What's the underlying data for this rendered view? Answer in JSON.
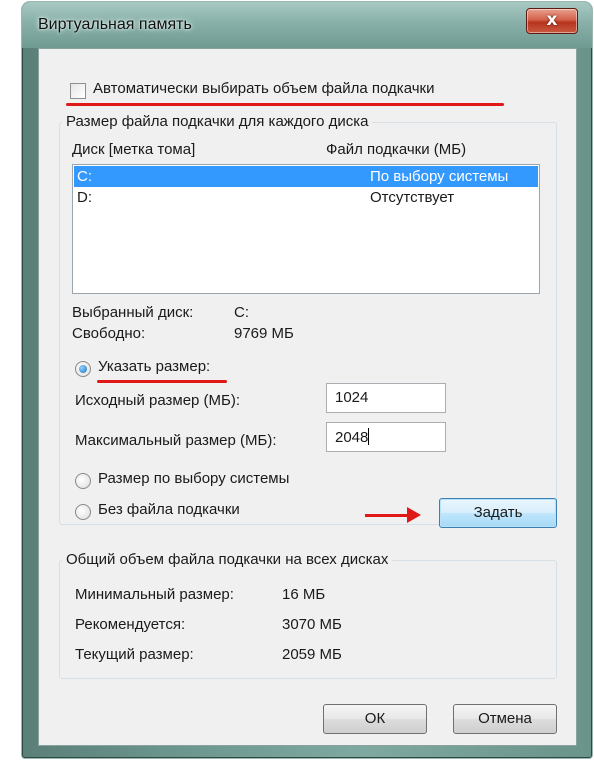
{
  "window": {
    "title": "Виртуальная память",
    "close_label": "x"
  },
  "auto_checkbox": {
    "label": "Автоматически выбирать объем файла подкачки",
    "checked": false
  },
  "drives_group": {
    "title": "Размер файла подкачки для каждого диска",
    "col_drive": "Диск [метка тома]",
    "col_pagefile": "Файл подкачки (МБ)",
    "rows": [
      {
        "drive": "C:",
        "pagefile": "По выбору системы",
        "selected": true
      },
      {
        "drive": "D:",
        "pagefile": "Отсутствует",
        "selected": false
      }
    ],
    "selected_disk_label": "Выбранный диск:",
    "selected_disk_value": "C:",
    "free_label": "Свободно:",
    "free_value": "9769 МБ",
    "custom_size_label": "Указать размер:",
    "initial_label": "Исходный размер (МБ):",
    "initial_value": "1024",
    "max_label": "Максимальный размер (МБ):",
    "max_value": "2048",
    "system_size_label": "Размер по выбору системы",
    "no_pagefile_label": "Без файла подкачки",
    "set_button": "Задать"
  },
  "total_group": {
    "title": "Общий объем файла подкачки на всех дисках",
    "min_label": "Минимальный размер:",
    "min_value": "16 МБ",
    "recommended_label": "Рекомендуется:",
    "recommended_value": "3070 МБ",
    "current_label": "Текущий размер:",
    "current_value": "2059 МБ"
  },
  "buttons": {
    "ok": "ОК",
    "cancel": "Отмена"
  },
  "colors": {
    "annotation_red": "#e01818",
    "selection_blue": "#3399ff"
  }
}
